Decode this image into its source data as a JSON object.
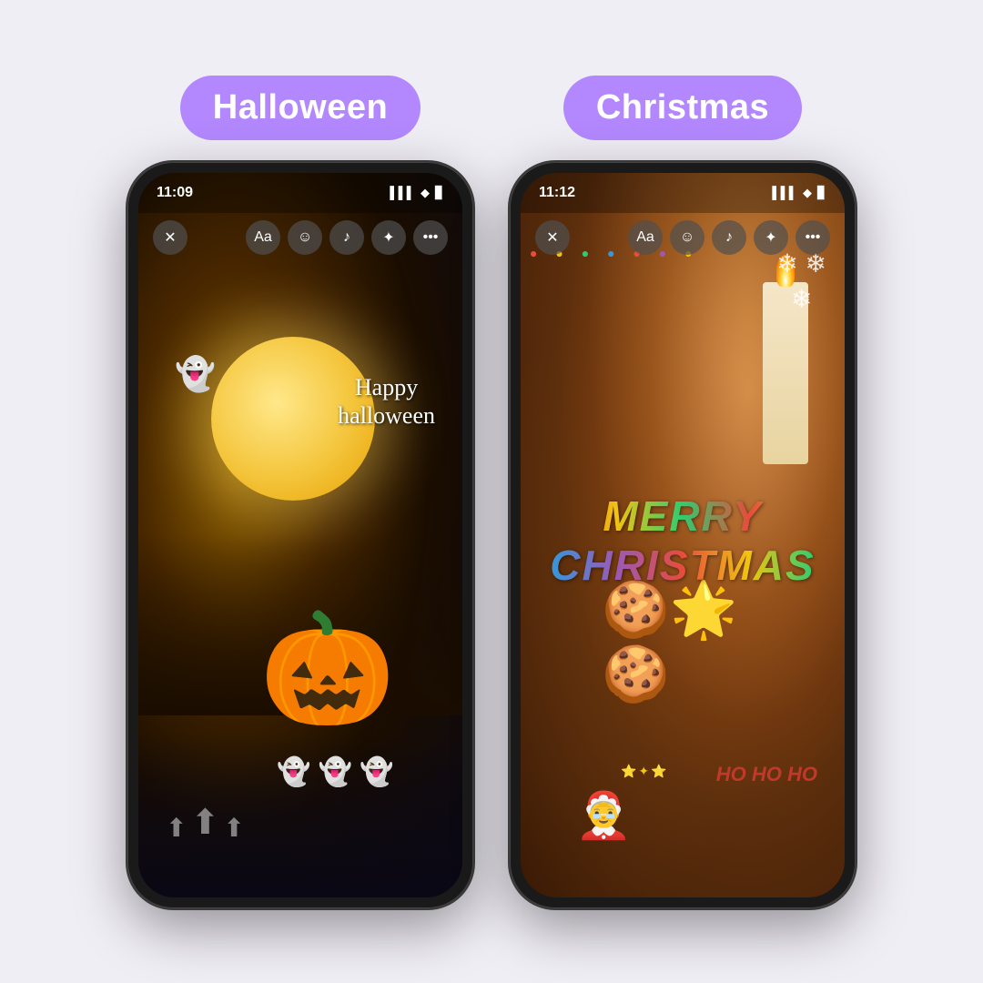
{
  "page": {
    "background": "#f0eef5"
  },
  "sections": [
    {
      "id": "halloween",
      "label": "Halloween",
      "badge_color": "#b388ff",
      "phone": {
        "time": "11:09",
        "status_icons": "▌▌▌ ◆ ▊",
        "toolbar": {
          "close": "✕",
          "text": "Aa",
          "sticker": "☺",
          "music": "♪",
          "sparkle": "✦",
          "more": "•••"
        },
        "overlay_text": "Happy\nhalloween",
        "ghost_top": "👻",
        "ghosts_bottom": "👻 👻 👻",
        "pumpkin": "🎃"
      }
    },
    {
      "id": "christmas",
      "label": "Christmas",
      "badge_color": "#b388ff",
      "phone": {
        "time": "11:12",
        "status_icons": "▌▌▌ ◆ ▊",
        "toolbar": {
          "close": "✕",
          "text": "Aa",
          "sticker": "☺",
          "music": "♪",
          "sparkle": "✦",
          "more": "•••"
        },
        "merry_line1": "MERRY",
        "merry_line2": "CHRISTMAS",
        "snowflakes": "❄ ❄\n  ❄",
        "ho_ho_ho": "HO\nHO\nHO",
        "santa": "🤶"
      }
    }
  ]
}
